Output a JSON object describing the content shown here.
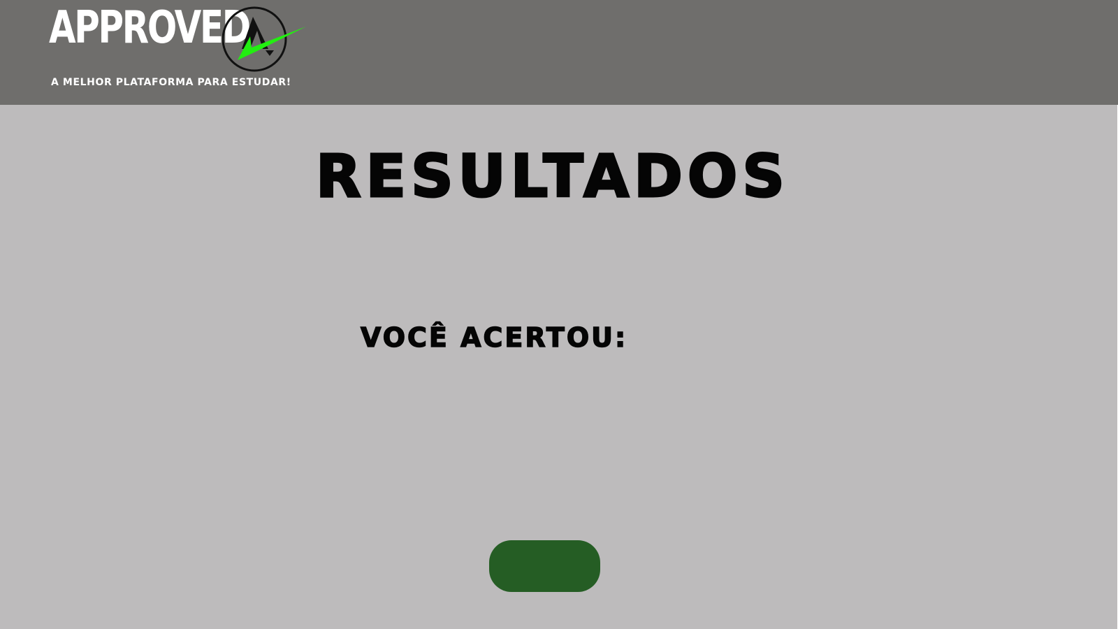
{
  "header": {
    "logo_text": "APPROVED",
    "logo_icon": "approved-a-check-badge",
    "tagline": "A MELHOR PLATAFORMA PARA ESTUDAR!"
  },
  "main": {
    "title": "RESULTADOS",
    "result_label": "VOCÊ ACERTOU:",
    "score_value": "",
    "action_button_label": ""
  },
  "colors": {
    "header_bg": "#6f6e6c",
    "page_bg": "#bdbbbc",
    "button_bg": "#255d24",
    "accent_green": "#22ee11",
    "text_dark": "#050505"
  }
}
